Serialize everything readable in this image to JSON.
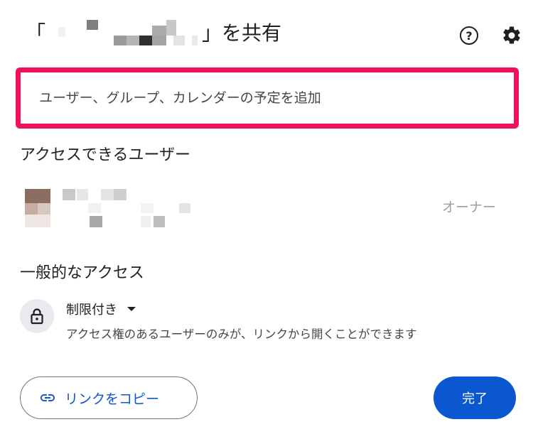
{
  "dialog": {
    "title_open_bracket": "「",
    "title_close_suffix": "」を共有",
    "add_field_placeholder": "ユーザー、グループ、カレンダーの予定を追加",
    "people_section_title": "アクセスできるユーザー",
    "owner_role": "オーナー",
    "general_access_title": "一般的なアクセス",
    "access_level": "制限付き",
    "access_description": "アクセス権のあるユーザーのみが、リンクから開くことができます",
    "copy_link_label": "リンクをコピー",
    "done_label": "完了",
    "help_icon_glyph": "?"
  },
  "colors": {
    "highlight_border": "#f2105a",
    "primary_blue": "#0b57d0",
    "role_text": "#9aa0a6"
  }
}
